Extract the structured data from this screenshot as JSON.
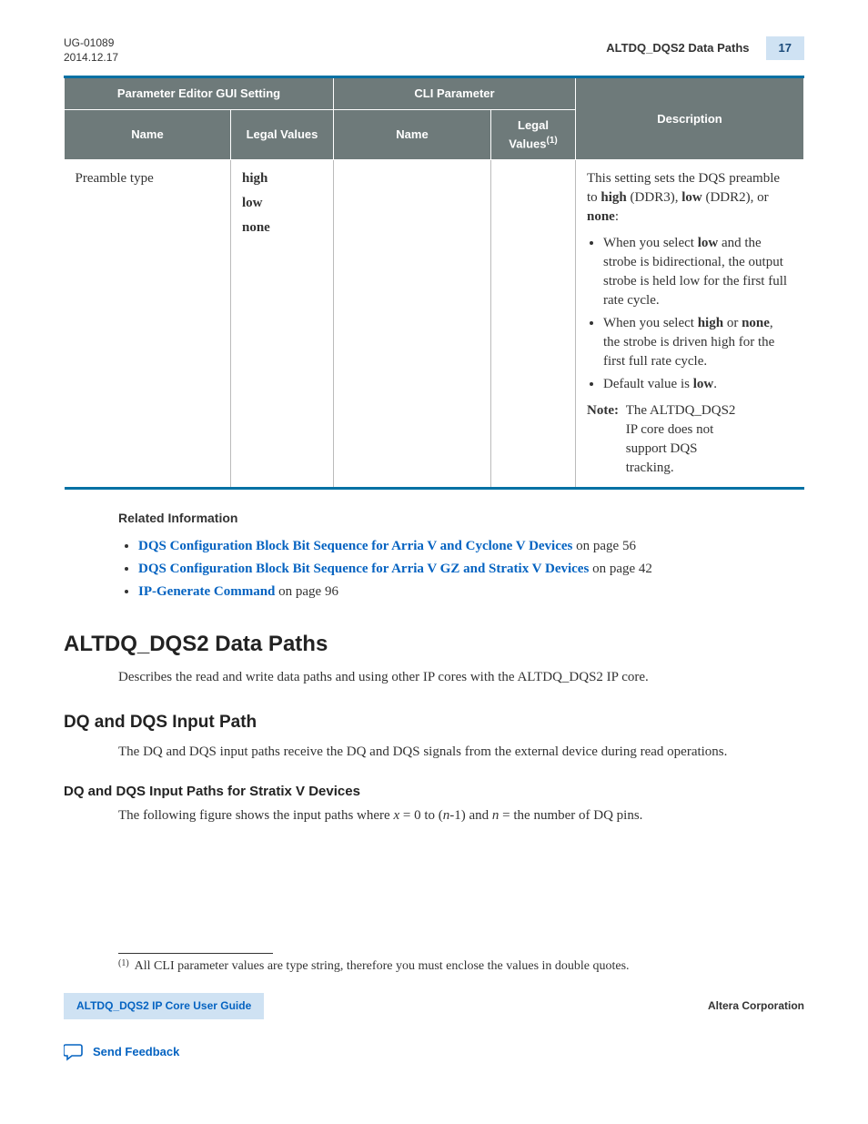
{
  "header": {
    "doc_id": "UG-01089",
    "date": "2014.12.17",
    "section_title": "ALTDQ_DQS2 Data Paths",
    "page_number": "17"
  },
  "table": {
    "group_headers": {
      "gui": "Parameter Editor GUI Setting",
      "cli": "CLI Parameter",
      "desc": "Description"
    },
    "sub_headers": {
      "gui_name": "Name",
      "gui_legal": "Legal Values",
      "cli_name": "Name",
      "cli_legal_prefix": "Legal Values",
      "cli_legal_sup": "(1)"
    },
    "row": {
      "name": "Preamble type",
      "legal_values": [
        "high",
        "low",
        "none"
      ],
      "desc_intro_pre": "This setting sets the DQS preamble to ",
      "desc_intro_high": "high",
      "desc_intro_mid1": " (DDR3), ",
      "desc_intro_low": "low",
      "desc_intro_mid2": " (DDR2), or ",
      "desc_intro_none": "none",
      "desc_intro_post": ":",
      "bullets": {
        "b1_pre": "When you select ",
        "b1_bold": "low",
        "b1_post": " and the strobe is bidirectional, the output strobe is held low for the first full rate cycle.",
        "b2_pre": "When you select ",
        "b2_bold1": "high",
        "b2_mid": " or ",
        "b2_bold2": "none",
        "b2_post": ", the strobe is driven high for the first full rate cycle.",
        "b3_pre": "Default value is ",
        "b3_bold": "low",
        "b3_post": "."
      },
      "note_label": "Note:",
      "note_text": "The ALTDQ_DQS2 IP core does not support DQS tracking."
    }
  },
  "related": {
    "heading": "Related Information",
    "items": [
      {
        "link": "DQS Configuration Block Bit Sequence for Arria V and Cyclone V Devices",
        "suffix": " on page 56"
      },
      {
        "link": "DQS Configuration Block Bit Sequence for Arria V GZ and Stratix V Devices",
        "suffix": " on page 42"
      },
      {
        "link": "IP-Generate Command",
        "suffix": " on page 96"
      }
    ]
  },
  "h1": "ALTDQ_DQS2 Data Paths",
  "p1": "Describes the read and write data paths and using other IP cores with the ALTDQ_DQS2 IP core.",
  "h2": "DQ and DQS Input Path",
  "p2": "The DQ and DQS input paths receive the DQ and DQS signals from the external device during read operations.",
  "h3": "DQ and DQS Input Paths for Stratix V Devices",
  "p3_pre": "The following figure shows the input paths where ",
  "p3_x": "x",
  "p3_mid1": " = 0 to (",
  "p3_n": "n",
  "p3_mid2": "-1) and ",
  "p3_n2": "n",
  "p3_post": " = the number of DQ pins.",
  "footnote": {
    "mark": "(1)",
    "text": "All CLI parameter values are type string, therefore you must enclose the values in double quotes."
  },
  "footer": {
    "left": "ALTDQ_DQS2 IP Core User Guide",
    "right": "Altera Corporation",
    "feedback": "Send Feedback"
  }
}
